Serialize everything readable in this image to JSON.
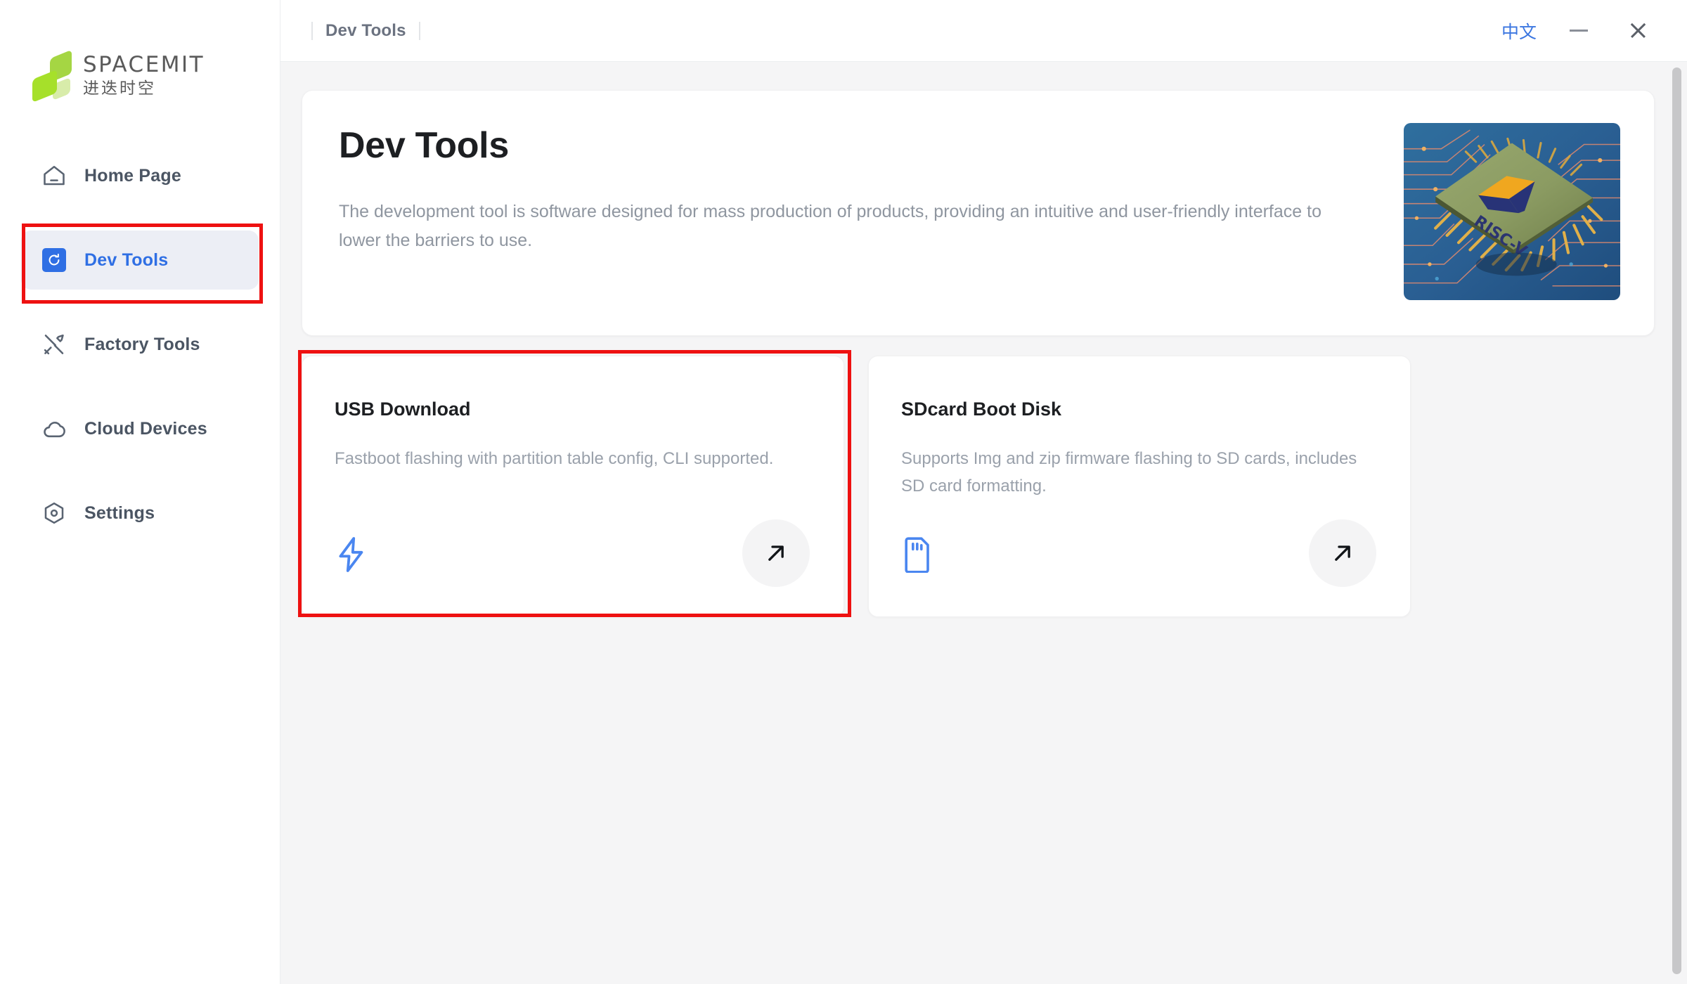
{
  "titlebar": {
    "breadcrumb": "Dev Tools",
    "language_toggle": "中文",
    "minimize_label": "−",
    "close_label": "×"
  },
  "sidebar": {
    "logo": {
      "wordmark": "SPACEMIT",
      "subtitle": "进迭时空",
      "colors": {
        "bright": "#a6e02a",
        "medium": "#a5d643",
        "pale": "#d8ecaa"
      }
    },
    "items": [
      {
        "id": "home-page",
        "label": "Home Page",
        "icon": "home-icon",
        "active": false
      },
      {
        "id": "dev-tools",
        "label": "Dev Tools",
        "icon": "refresh-badge-icon",
        "active": true
      },
      {
        "id": "factory-tools",
        "label": "Factory Tools",
        "icon": "tools-icon",
        "active": false
      },
      {
        "id": "cloud-devices",
        "label": "Cloud Devices",
        "icon": "cloud-icon",
        "active": false
      },
      {
        "id": "settings",
        "label": "Settings",
        "icon": "gear-hex-icon",
        "active": false
      }
    ],
    "active_color": "#2f6fe4",
    "active_bg": "#eceef5"
  },
  "hero": {
    "title": "Dev Tools",
    "description": "The development tool is software designed for mass production of products, providing an intuitive and user-friendly interface to lower the barriers to use.",
    "image_alt": "risc-v-chip-illustration"
  },
  "cards": [
    {
      "id": "usb-download",
      "title": "USB Download",
      "description": "Fastboot flashing with partition table config, CLI supported.",
      "glyph": "lightning-bolt-icon",
      "glyph_color": "#4a86f0",
      "action": "open-arrow-icon",
      "highlighted": true
    },
    {
      "id": "sdcard-boot-disk",
      "title": "SDcard Boot Disk",
      "description": "Supports Img and zip firmware flashing to SD cards, includes SD card formatting.",
      "glyph": "sd-card-icon",
      "glyph_color": "#4a86f0",
      "action": "open-arrow-icon",
      "highlighted": false
    }
  ],
  "annotations": {
    "color": "#ee1111",
    "targets": [
      "sidebar-item-dev-tools",
      "card-usb-download"
    ]
  }
}
